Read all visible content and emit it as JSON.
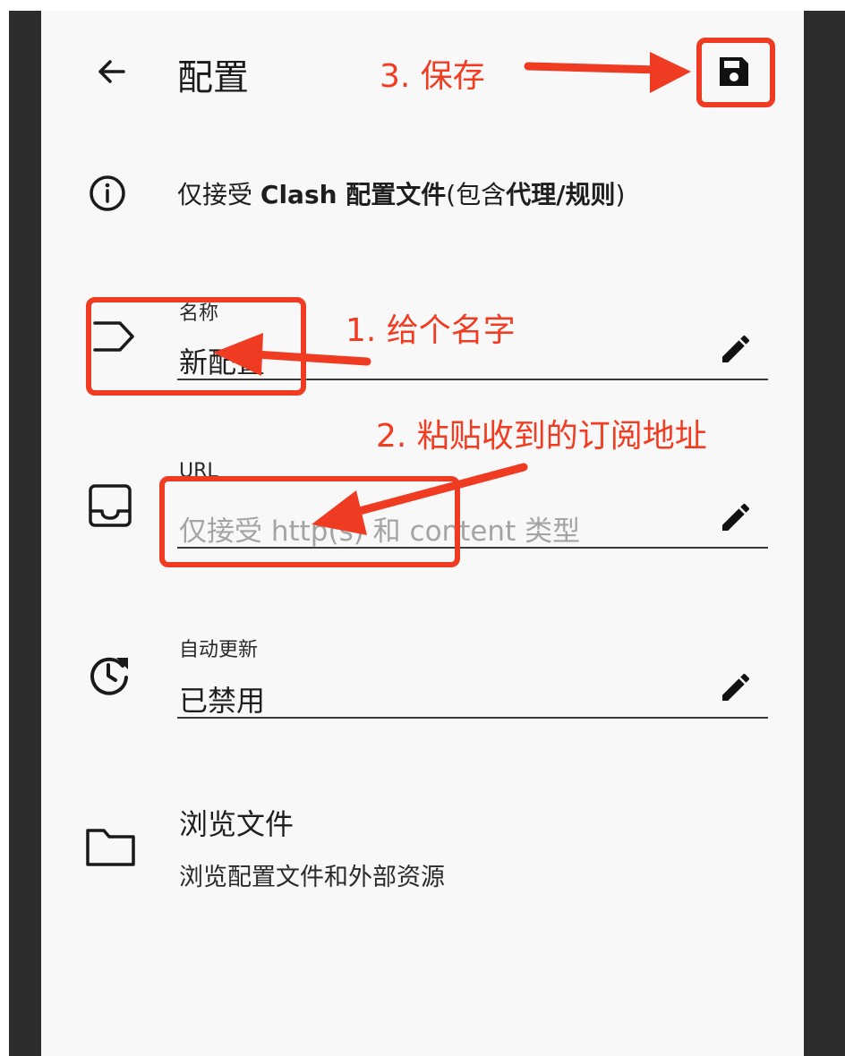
{
  "header": {
    "title": "配置",
    "back_icon": "arrow-left-icon",
    "save_icon": "save-icon"
  },
  "info": {
    "icon": "info-icon",
    "text_prefix": "仅接受 ",
    "text_bold1": "Clash 配置文件",
    "text_mid": "(包含",
    "text_bold2": "代理/规则",
    "text_suffix": ")"
  },
  "fields": [
    {
      "icon": "tag-icon",
      "label": "名称",
      "value": "新配置",
      "edit_icon": "pencil-icon"
    },
    {
      "icon": "inbox-icon",
      "label": "URL",
      "placeholder": "仅接受 http(s) 和 content 类型",
      "edit_icon": "pencil-icon"
    },
    {
      "icon": "update-clock-icon",
      "label": "自动更新",
      "value": "已禁用",
      "edit_icon": "pencil-icon"
    }
  ],
  "browse": {
    "icon": "folder-icon",
    "title": "浏览文件",
    "subtitle": "浏览配置文件和外部资源"
  },
  "annotations": {
    "step1": "1. 给个名字",
    "step2": "2. 粘贴收到的订阅地址",
    "step3": "3. 保存",
    "color": "#ee3b22"
  }
}
